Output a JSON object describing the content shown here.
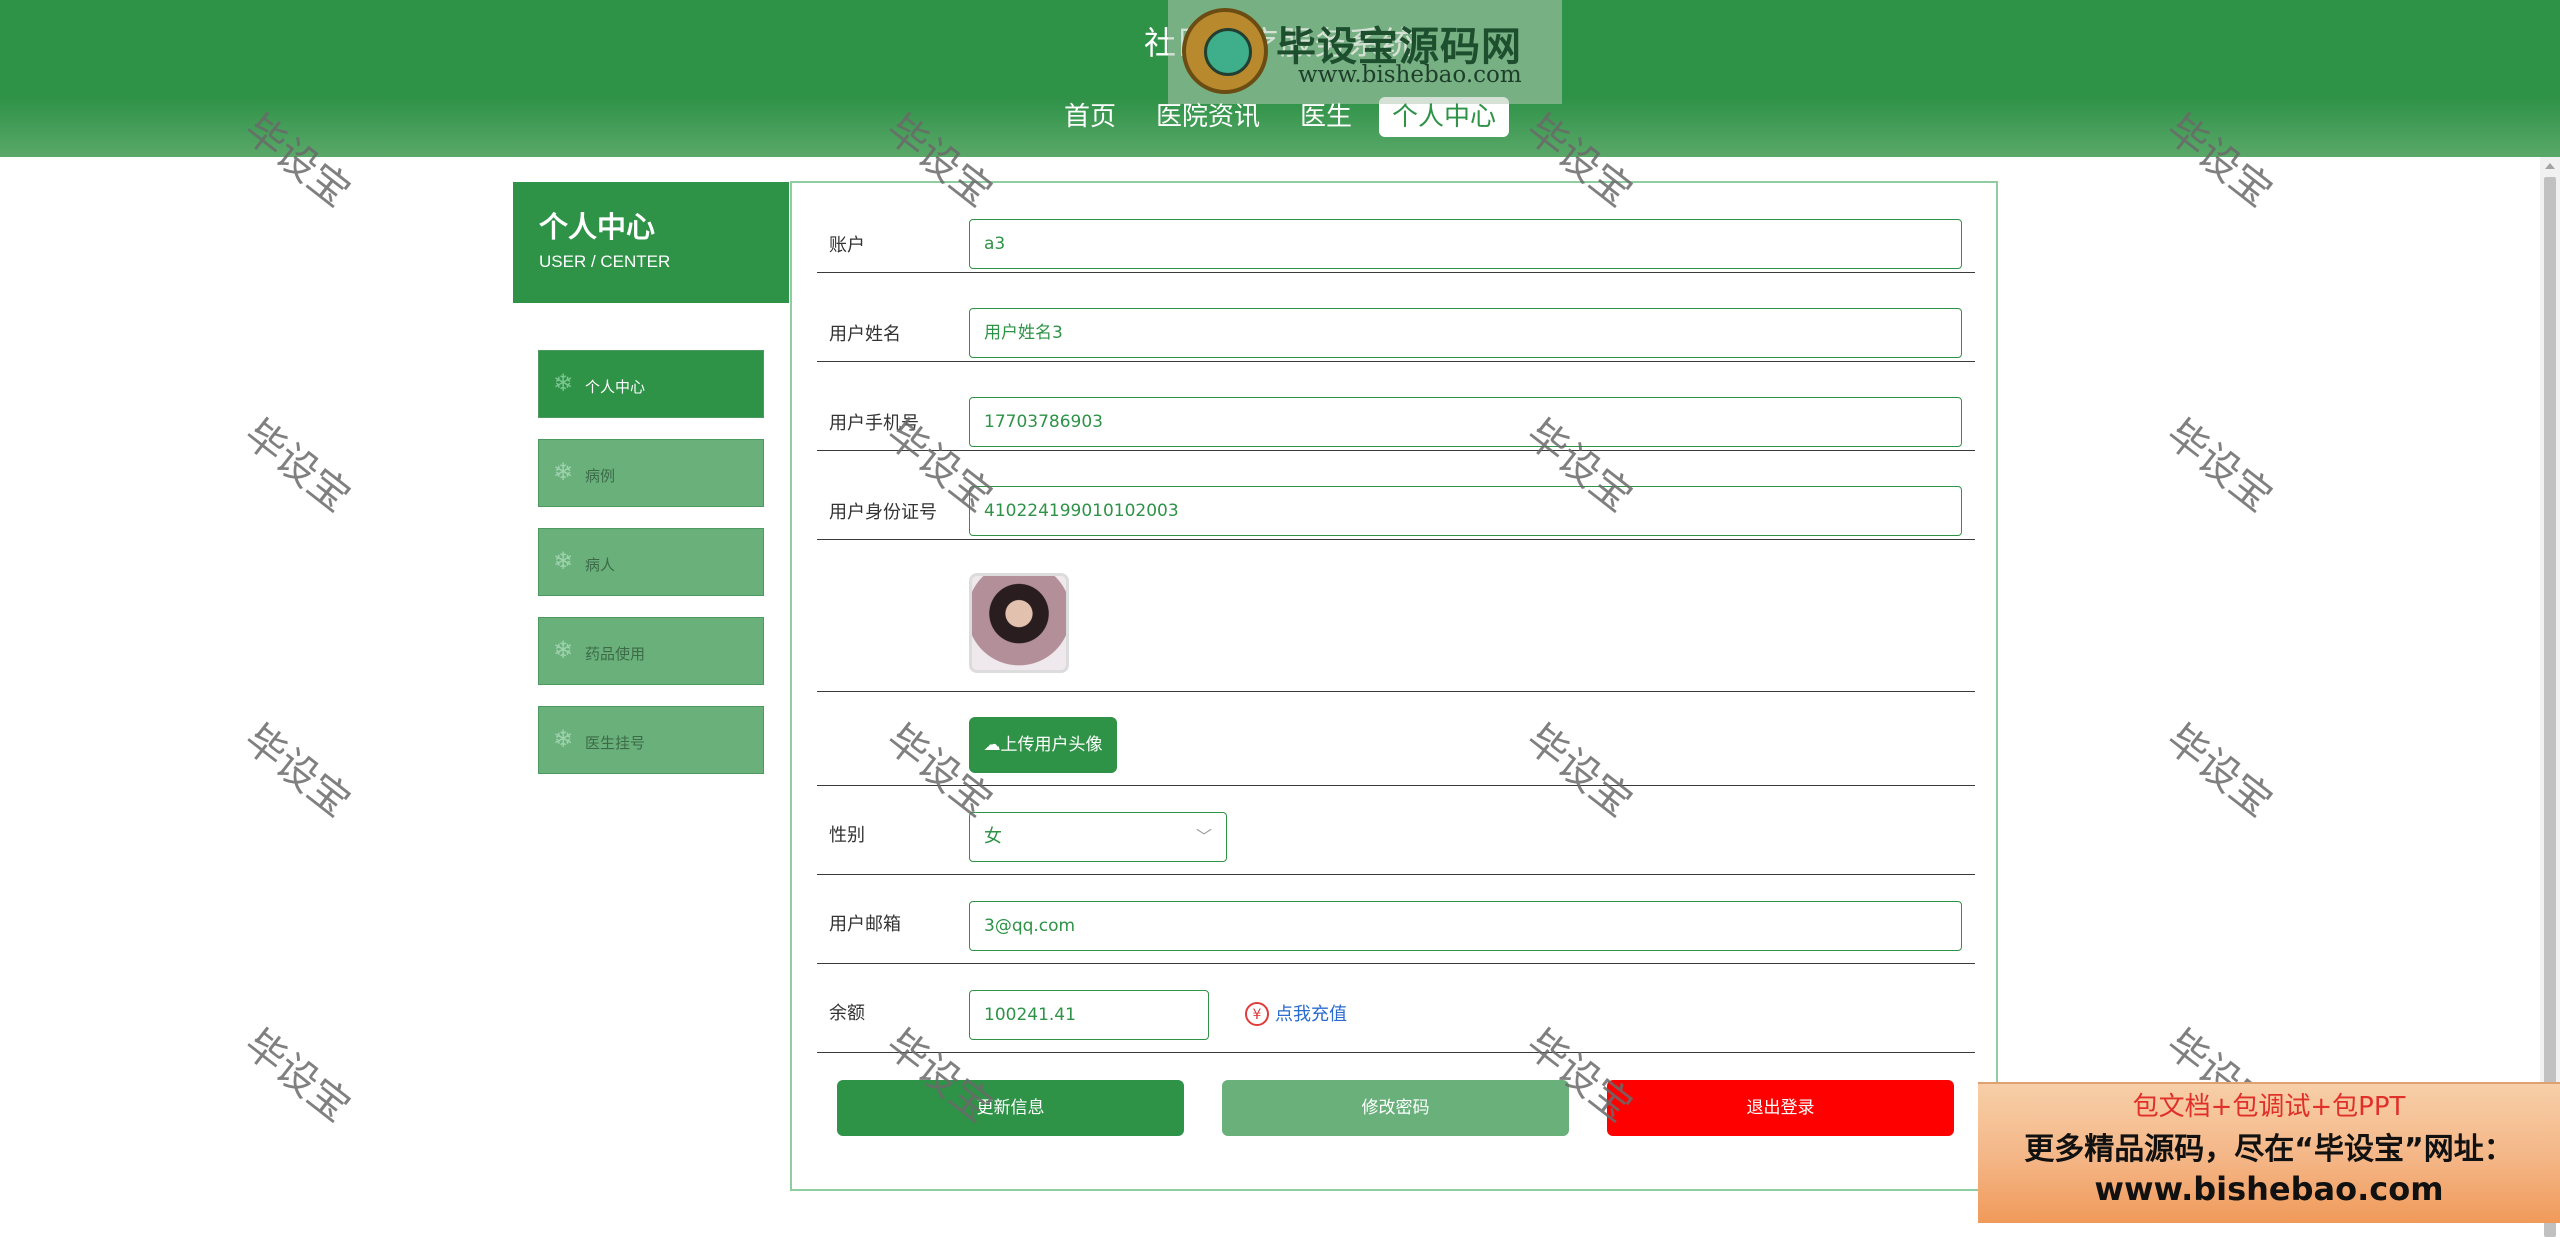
{
  "header": {
    "site_title": "社区医疗服务系统",
    "nav": [
      {
        "label": "首页"
      },
      {
        "label": "医院资讯"
      },
      {
        "label": "医生"
      },
      {
        "label": "个人中心"
      }
    ],
    "active_nav": "个人中心",
    "logo": {
      "title": "毕设宝源码网",
      "url": "www.bishebao.com"
    }
  },
  "sidebar": {
    "title": "个人中心",
    "subtitle": "USER / CENTER",
    "items": [
      {
        "label": "个人中心",
        "icon": "snowflake-icon"
      },
      {
        "label": "病例",
        "icon": "snowflake-icon"
      },
      {
        "label": "病人",
        "icon": "snowflake-icon"
      },
      {
        "label": "药品使用",
        "icon": "snowflake-icon"
      },
      {
        "label": "医生挂号",
        "icon": "snowflake-icon"
      }
    ]
  },
  "form": {
    "account": {
      "label": "账户",
      "value": "a3"
    },
    "user_name": {
      "label": "用户姓名",
      "value": "用户姓名3"
    },
    "phone": {
      "label": "用户手机号",
      "value": "17703786903"
    },
    "id_card": {
      "label": "用户身份证号",
      "value": "410224199010102003"
    },
    "avatar": {
      "upload_label": "上传用户头像",
      "icon": "cloud-upload-icon"
    },
    "gender": {
      "label": "性别",
      "value": "女"
    },
    "email": {
      "label": "用户邮箱",
      "value": "3@qq.com"
    },
    "balance": {
      "label": "余额",
      "value": "100241.41",
      "recharge_label": "点我充值",
      "recharge_icon": "¥"
    },
    "buttons": {
      "update": "更新信息",
      "password": "修改密码",
      "logout": "退出登录"
    }
  },
  "watermark": "毕设宝",
  "ad": {
    "line1": "包文档+包调试+包PPT",
    "line2": "更多精品源码，尽在“毕设宝”网址：",
    "line3": "www.bishebao.com"
  },
  "colors": {
    "primary": "#2e9247",
    "secondary": "#69b07b",
    "danger": "#ff0000",
    "link": "#2a6bd0"
  }
}
